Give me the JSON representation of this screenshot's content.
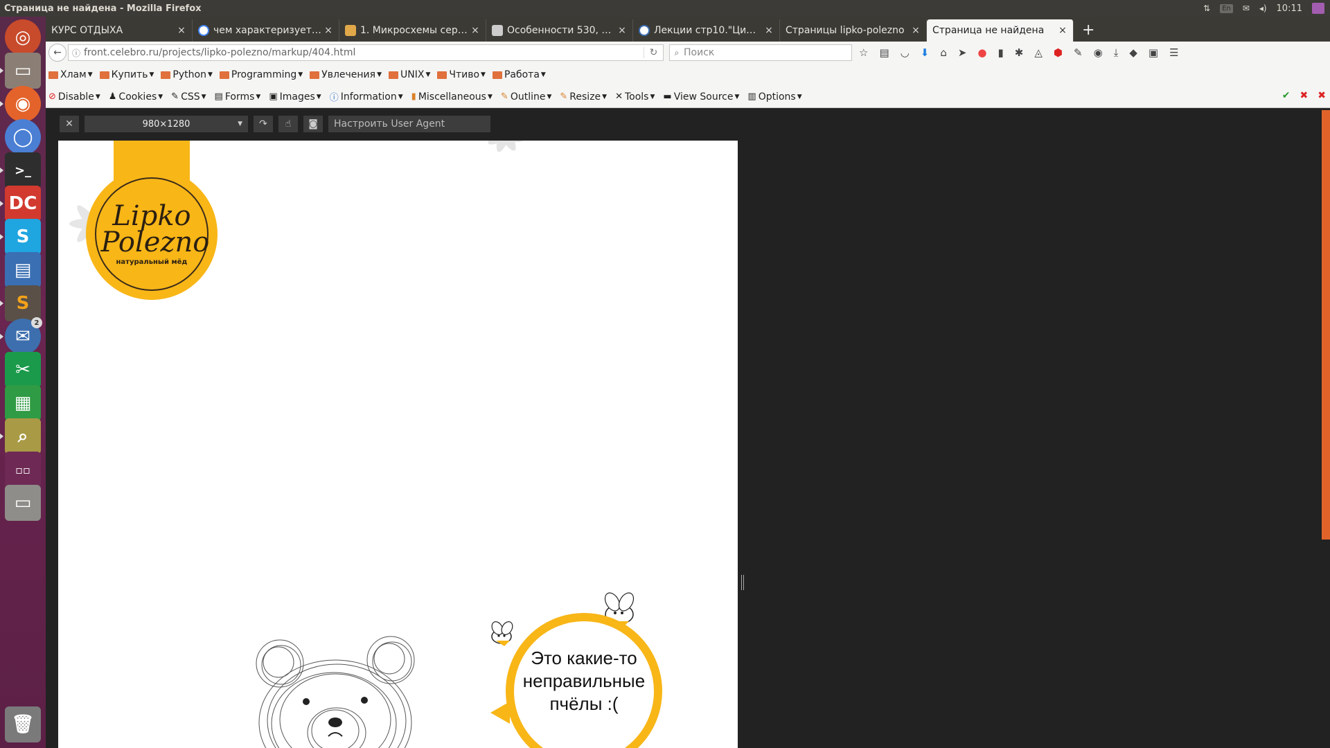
{
  "window": {
    "title": "Страница не найдена - Mozilla Firefox"
  },
  "tray": {
    "lang": "En",
    "clock": "10:11"
  },
  "tabs": [
    {
      "label": "КУРС ОТДЫХА"
    },
    {
      "label": "чем характеризует…"
    },
    {
      "label": "1. Микросхемы сер…"
    },
    {
      "label": "Особенности 530, …"
    },
    {
      "label": "Лекции стр10.\"Ци…"
    },
    {
      "label": "Страницы lipko-polezno"
    },
    {
      "label": "Страница не найдена"
    }
  ],
  "navbar": {
    "url": "front.celebro.ru/projects/lipko-polezno/markup/404.html",
    "search_placeholder": "Поиск"
  },
  "bookmarks": [
    {
      "label": "Хлам"
    },
    {
      "label": "Купить"
    },
    {
      "label": "Python"
    },
    {
      "label": "Programming"
    },
    {
      "label": "Увлечения"
    },
    {
      "label": "UNIX"
    },
    {
      "label": "Чтиво"
    },
    {
      "label": "Работа"
    }
  ],
  "devtools": [
    {
      "label": "Disable"
    },
    {
      "label": "Cookies"
    },
    {
      "label": "CSS"
    },
    {
      "label": "Forms"
    },
    {
      "label": "Images"
    },
    {
      "label": "Information"
    },
    {
      "label": "Miscellaneous"
    },
    {
      "label": "Outline"
    },
    {
      "label": "Resize"
    },
    {
      "label": "Tools"
    },
    {
      "label": "View Source"
    },
    {
      "label": "Options"
    }
  ],
  "responsive": {
    "size": "980×1280",
    "ua_placeholder": "Настроить User Agent"
  },
  "page": {
    "logo_line1": "Lipko",
    "logo_line2": "Polezno",
    "logo_tagline": "натуральный мёд",
    "bubble_line1": "Это какие-то",
    "bubble_line2": "неправильные",
    "bubble_line3": "пчёлы :("
  },
  "colors": {
    "brand": "#f8b617",
    "launcher": "#5c2046"
  }
}
